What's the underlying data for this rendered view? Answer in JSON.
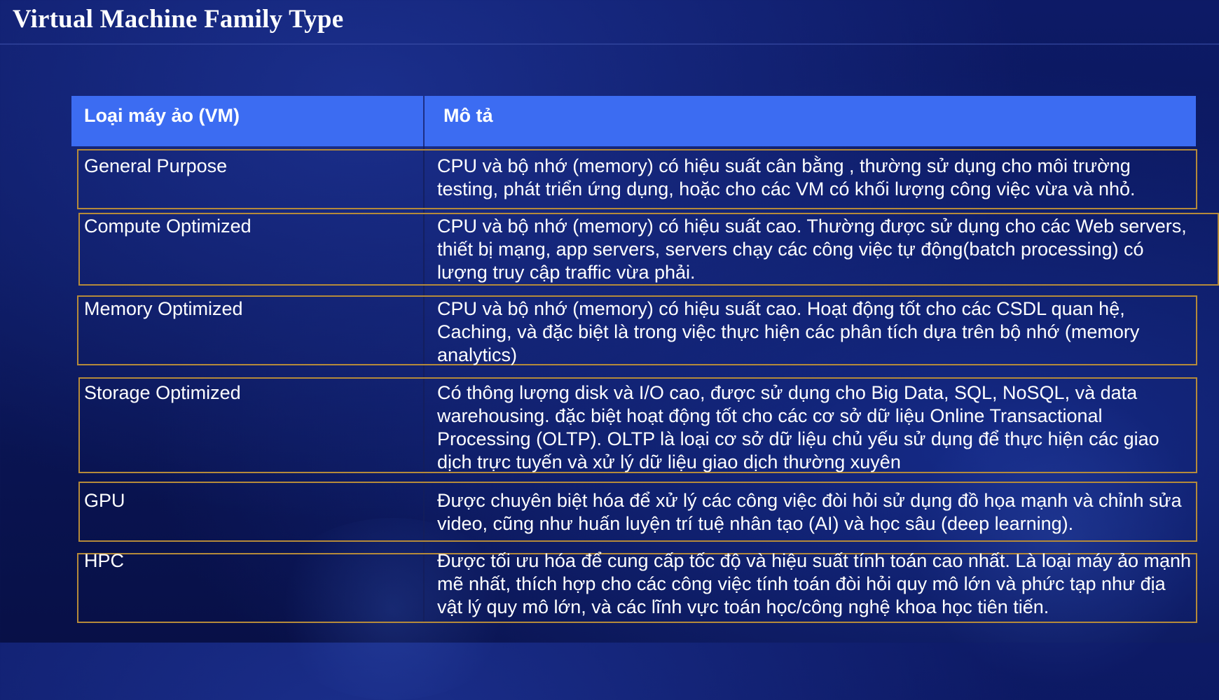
{
  "slide": {
    "title": "Virtual Machine Family Type"
  },
  "table": {
    "headers": {
      "col1": "Loại máy ảo (VM)",
      "col2": "Mô tả"
    },
    "rows": [
      {
        "name": "General Purpose",
        "description": "CPU và bộ nhớ (memory) có hiệu suất cân bằng , thường sử dụng cho môi trường testing, phát triển ứng dụng, hoặc cho các VM có khối lượng công việc vừa và nhỏ."
      },
      {
        "name": "Compute Optimized",
        "description": "CPU và bộ nhớ (memory) có hiệu suất cao. Thường được sử dụng cho các Web servers, thiết bị mạng, app servers, servers chạy các công việc tự động(batch processing) có lượng truy cập traffic vừa phải."
      },
      {
        "name": "Memory Optimized",
        "description": "CPU và bộ nhớ (memory) có hiệu suất cao. Hoạt động tốt cho các CSDL quan hệ, Caching, và đặc biệt là trong việc thực hiện các phân tích dựa trên bộ nhớ (memory analytics)"
      },
      {
        "name": "Storage Optimized",
        "description": "Có thông lượng disk và I/O cao, được sử dụng cho Big Data, SQL, NoSQL, và data warehousing. đặc biệt hoạt động tốt cho các cơ sở dữ liệu Online Transactional Processing (OLTP). OLTP là loại cơ sở dữ liệu chủ yếu sử dụng để thực hiện các giao dịch trực tuyến và xử lý dữ liệu giao dịch thường xuyên"
      },
      {
        "name": "GPU",
        "description": "Được chuyên biệt hóa để xử lý các công việc đòi hỏi sử dụng đồ họa mạnh và chỉnh sửa video, cũng như huấn luyện trí tuệ nhân tạo (AI) và học sâu (deep learning)."
      },
      {
        "name": "HPC",
        "description": "Được tối ưu hóa để cung cấp tốc độ và hiệu suất tính toán cao nhất. Là loại máy ảo mạnh mẽ nhất, thích hợp cho các công việc tính toán đòi hỏi quy mô lớn và phức tạp như địa vật lý quy mô lớn, và các lĩnh vực toán học/công nghệ khoa học tiên tiến."
      }
    ]
  }
}
